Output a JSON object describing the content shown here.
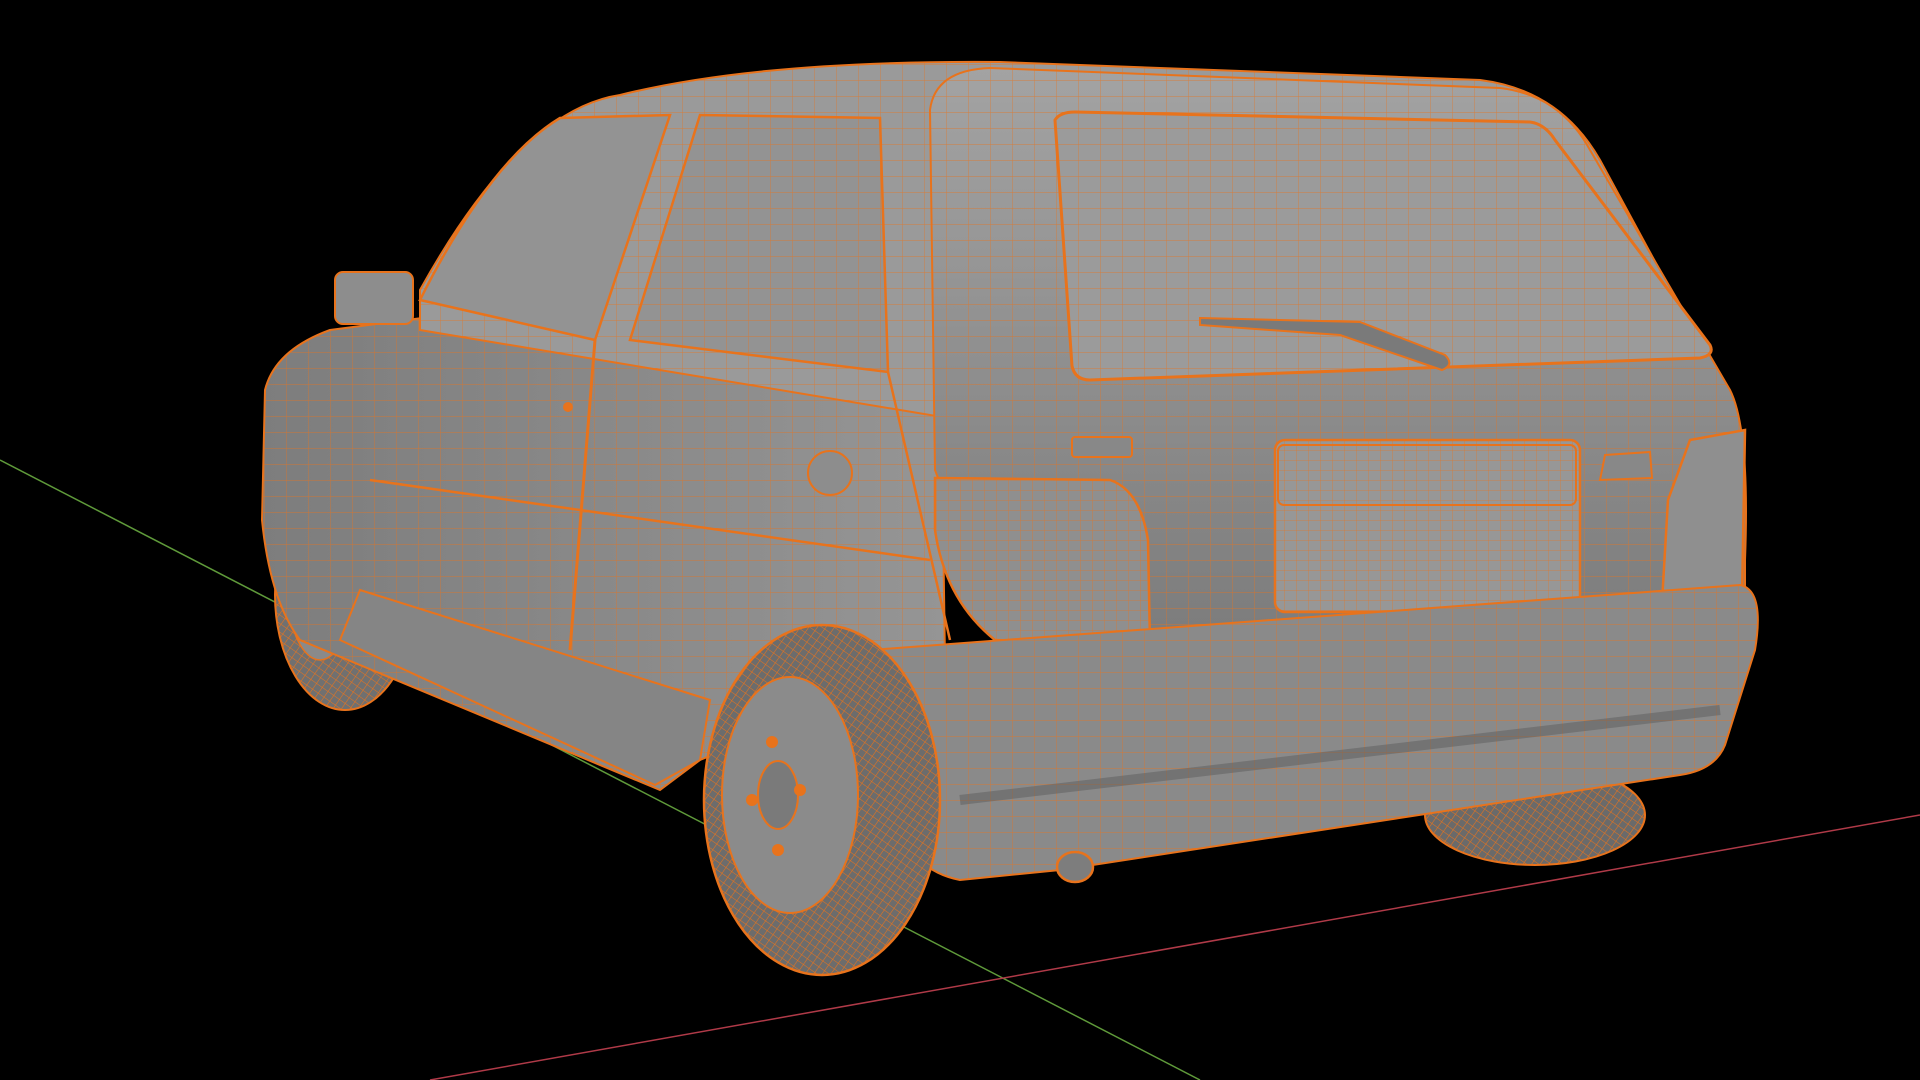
{
  "viewport": {
    "background_color": "#000000",
    "mode": "wireframe-overlay"
  },
  "colors": {
    "mesh_fill": "#8d8d8d",
    "mesh_fill_light": "#a3a3a3",
    "mesh_fill_dark": "#6f6f6f",
    "wireframe": "#e8731c",
    "axis_x": "#b03a48",
    "axis_y": "#5f9a3a"
  },
  "icons": {
    "car": "car-mesh-icon"
  }
}
